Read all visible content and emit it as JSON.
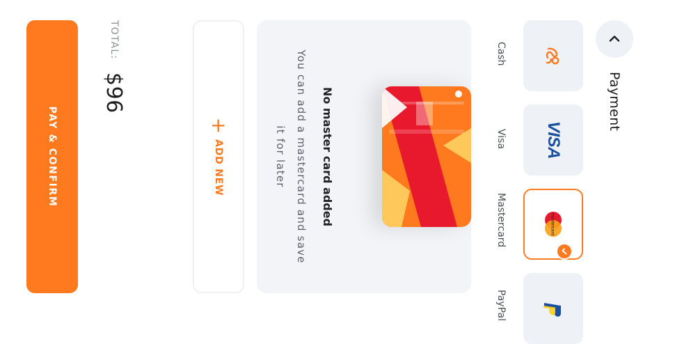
{
  "header": {
    "title": "Payment"
  },
  "methods": [
    {
      "label": "Cash",
      "icon": "cash-hand-icon",
      "selected": false
    },
    {
      "label": "Visa",
      "icon": "visa-logo",
      "logo_text": "VISA",
      "selected": false
    },
    {
      "label": "Mastercard",
      "icon": "mastercard-logo",
      "logo_text": "mastercard",
      "selected": true
    },
    {
      "label": "PayPal",
      "icon": "paypal-logo",
      "selected": false
    }
  ],
  "empty_state": {
    "title": "No master card added",
    "subtitle": "You can add a mastercard and save it for later"
  },
  "add_new": {
    "label": "ADD NEW"
  },
  "totals": {
    "label": "TOTAL:",
    "amount": "$96"
  },
  "pay_button": {
    "label": "PAY & CONFIRM"
  },
  "colors": {
    "accent": "#ff7a1f",
    "tile_bg": "#eef2f6",
    "panel_bg": "#f2f4f7",
    "card_red": "#e8192c",
    "card_yellow": "#ffc85a",
    "visa_blue": "#1a4fa0"
  }
}
